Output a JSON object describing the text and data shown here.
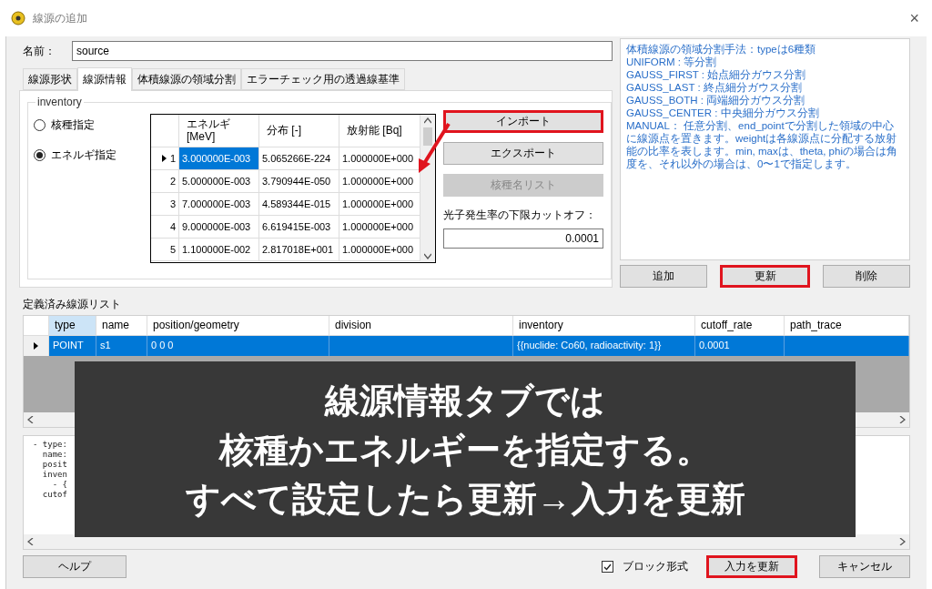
{
  "window": {
    "title": "線源の追加",
    "close": "×"
  },
  "name_field": {
    "label": "名前：",
    "value": "source"
  },
  "tabs": [
    {
      "label": "線源形状",
      "selected": false
    },
    {
      "label": "線源情報",
      "selected": true
    },
    {
      "label": "体積線源の領域分割",
      "selected": false
    },
    {
      "label": "エラーチェック用の透過線基準",
      "selected": false
    }
  ],
  "inventory": {
    "title": "inventory",
    "options": [
      {
        "label": "核種指定",
        "selected": false
      },
      {
        "label": "エネルギ指定",
        "selected": true
      }
    ],
    "table": {
      "columns": [
        "エネルギ\n[MeV]",
        "分布 [-]",
        "放射能 [Bq]"
      ],
      "rows": [
        {
          "number": "1",
          "current": true,
          "cells": [
            "3.000000E-003",
            "5.065266E-224",
            "1.000000E+000"
          ]
        },
        {
          "number": "2",
          "current": false,
          "cells": [
            "5.000000E-003",
            "3.790944E-050",
            "1.000000E+000"
          ]
        },
        {
          "number": "3",
          "current": false,
          "cells": [
            "7.000000E-003",
            "4.589344E-015",
            "1.000000E+000"
          ]
        },
        {
          "number": "4",
          "current": false,
          "cells": [
            "9.000000E-003",
            "6.619415E-003",
            "1.000000E+000"
          ]
        },
        {
          "number": "5",
          "current": false,
          "cells": [
            "1.100000E-002",
            "2.817018E+001",
            "1.000000E+000"
          ]
        }
      ]
    },
    "buttons": [
      {
        "label": "インポート",
        "disabled": false,
        "highlighted": true
      },
      {
        "label": "エクスポート",
        "disabled": false,
        "highlighted": false
      },
      {
        "label": "核種名リスト",
        "disabled": true,
        "highlighted": false
      }
    ],
    "cutoff": {
      "label": "光子発生率の下限カットオフ：",
      "value": "0.0001"
    }
  },
  "description": [
    "体積線源の領域分割手法：typeは6種類",
    "UNIFORM : 等分割",
    "GAUSS_FIRST : 始点細分ガウス分割",
    "GAUSS_LAST : 終点細分ガウス分割",
    "GAUSS_BOTH : 両端細分ガウス分割",
    "GAUSS_CENTER : 中央細分ガウス分割",
    "MANUAL： 任意分割、end_pointで分割した領域の中心に線源点を置きます。weightは各線源点に分配する放射能の比率を表します。min, maxは、theta, phiの場合は角度を、それ以外の場合は、0〜1で指定します。"
  ],
  "list_buttons": [
    {
      "label": "追加",
      "highlighted": false
    },
    {
      "label": "更新",
      "highlighted": true
    },
    {
      "label": "削除",
      "highlighted": false
    }
  ],
  "source_list": {
    "title": "定義済み線源リスト",
    "columns": [
      "type",
      "name",
      "position/geometry",
      "division",
      "inventory",
      "cutoff_rate",
      "path_trace"
    ],
    "rows": [
      {
        "selected": true,
        "cells": [
          "POINT",
          "s1",
          "0 0 0",
          "",
          "{{nuclide: Co60, radioactivity: 1}}",
          "0.0001",
          ""
        ]
      }
    ]
  },
  "yaml": [
    "- type:",
    "  name:",
    "  posit",
    "  inven",
    "    - {",
    "  cutof"
  ],
  "footer": {
    "help": "ヘルプ",
    "block": {
      "label": "ブロック形式",
      "checked": true
    },
    "buttons": [
      {
        "label": "入力を更新",
        "highlighted": true
      },
      {
        "label": "キャンセル",
        "highlighted": false
      }
    ]
  },
  "caption": [
    "線源情報タブでは",
    "核種かエネルギーを指定する。",
    "すべて設定したら更新→入力を更新"
  ]
}
